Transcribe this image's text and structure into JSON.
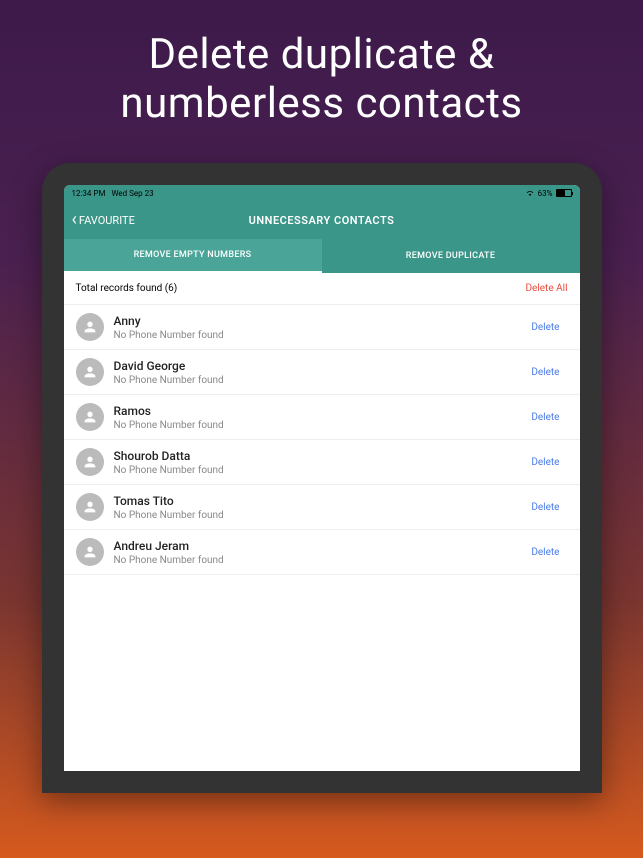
{
  "promo": {
    "line1": "Delete duplicate &",
    "line2": "numberless contacts"
  },
  "statusBar": {
    "time": "12:34 PM",
    "date": "Wed Sep 23",
    "battery": "63%"
  },
  "nav": {
    "back": "FAVOURITE",
    "title": "UNNECESSARY CONTACTS"
  },
  "tabs": {
    "tab1": "REMOVE EMPTY NUMBERS",
    "tab2": "REMOVE DUPLICATE"
  },
  "summary": {
    "text": "Total records found (6)",
    "deleteAll": "Delete All"
  },
  "deleteLabel": "Delete",
  "contacts": [
    {
      "name": "Anny",
      "sub": "No Phone Number found"
    },
    {
      "name": "David George",
      "sub": "No Phone Number found"
    },
    {
      "name": "Ramos",
      "sub": "No Phone Number found"
    },
    {
      "name": "Shourob Datta",
      "sub": "No Phone Number found"
    },
    {
      "name": "Tomas Tito",
      "sub": "No Phone Number found"
    },
    {
      "name": "Andreu Jeram",
      "sub": "No Phone Number found"
    }
  ]
}
